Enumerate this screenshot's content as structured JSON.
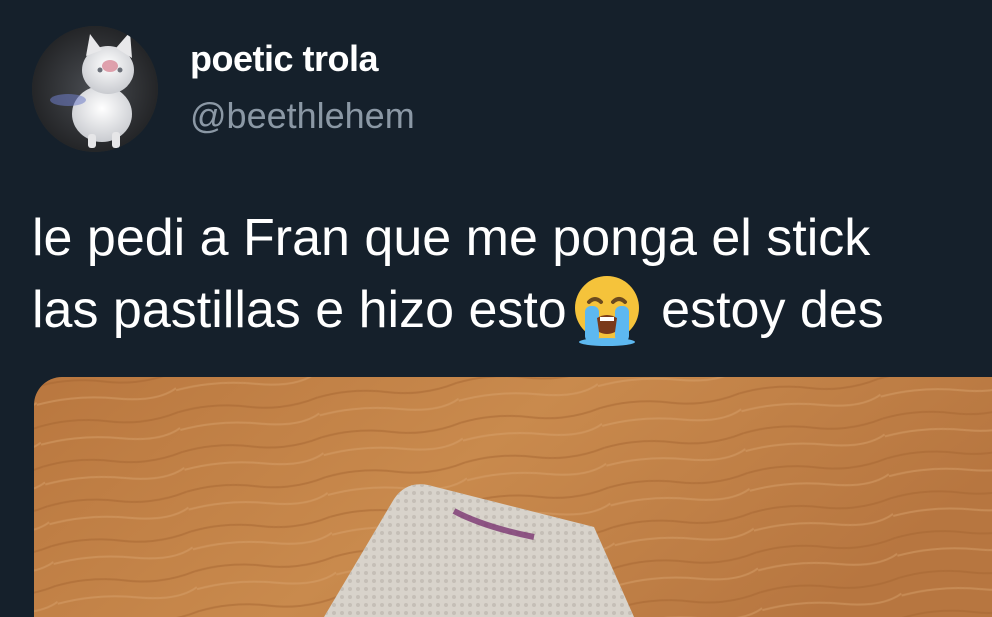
{
  "tweet": {
    "author": {
      "display_name": "poetic trola",
      "handle": "@beethlehem",
      "avatar_icon": "white-kitten-avatar"
    },
    "text": {
      "line1": "le pedi a Fran que me ponga el stick",
      "line2_before_emoji": "las pastillas e hizo esto",
      "emoji": "loudly-crying-face-icon",
      "line2_after_emoji": " estoy des"
    },
    "media": {
      "description_icon": "pill-blister-pack-photo"
    }
  },
  "colors": {
    "background": "#15202b",
    "primary_text": "#ffffff",
    "secondary_text": "#8b98a5"
  }
}
